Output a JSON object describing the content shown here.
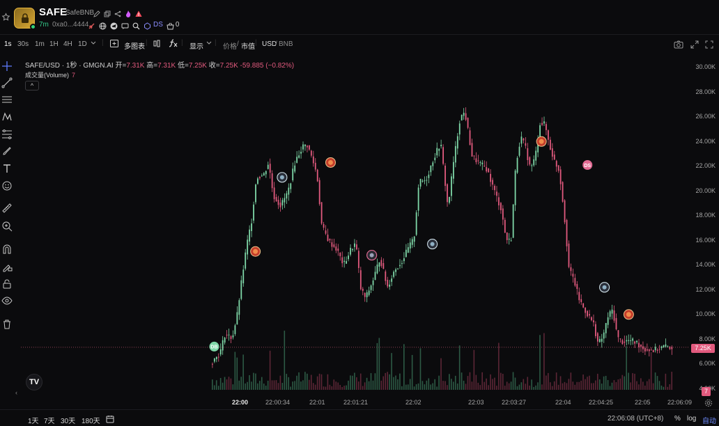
{
  "token": {
    "ticker": "SAFE",
    "name": "SafeBNB",
    "age": "7m",
    "address": "0xa0...4444",
    "ds_label": "DS",
    "count": "0"
  },
  "toolbar": {
    "intervals": [
      "1s",
      "30s",
      "1m",
      "1H",
      "4H",
      "1D"
    ],
    "active_interval": "1s",
    "multi_chart": "多图表",
    "display": "显示",
    "price": "价格",
    "mcap": "市值",
    "usd": "USD",
    "bnb": "BNB",
    "slash": "/"
  },
  "legend": {
    "symbol": "SAFE/USD · 1秒 · GMGN.AI",
    "open_label": "开=",
    "open": "7.31K",
    "high_label": "高=",
    "high": "7.31K",
    "low_label": "低=",
    "low": "7.25K",
    "close_label": "收=",
    "close": "7.25K",
    "change": "-59.885 (−0.82%)",
    "volume_label": "成交量(Volume)",
    "volume": "7",
    "fold": "^"
  },
  "y_axis": [
    "30.00K",
    "28.00K",
    "26.00K",
    "24.00K",
    "22.00K",
    "20.00K",
    "18.00K",
    "16.00K",
    "14.00K",
    "12.00K",
    "10.00K",
    "8.00K",
    "6.00K",
    "4.00K"
  ],
  "current_price": "7.25K",
  "current_volume": "7",
  "x_axis": [
    "22:00",
    "22:00:34",
    "22:01",
    "22:01:21",
    "22:02",
    "22:03",
    "22:03:27",
    "22:04",
    "22:04:25",
    "22:05",
    "22:06:09"
  ],
  "bottom": {
    "ranges": [
      "1天",
      "7天",
      "30天",
      "180天"
    ],
    "clock": "22:06:08 (UTC+8)",
    "percent": "%",
    "log": "log",
    "auto": "自动"
  },
  "colors": {
    "up": "#7fd8a8",
    "down": "#e25a7e",
    "accent": "#6f8dff"
  },
  "markers": [
    "DB",
    "DS"
  ],
  "tv_logo": "TV",
  "chart_data": {
    "type": "candlestick",
    "xlabel": "",
    "ylabel": "",
    "ylim": [
      4000,
      30000
    ],
    "price_path": [
      {
        "t": 0,
        "p": 5900
      },
      {
        "t": 4,
        "p": 6800
      },
      {
        "t": 6,
        "p": 8300
      },
      {
        "t": 9,
        "p": 8000
      },
      {
        "t": 11,
        "p": 9800
      },
      {
        "t": 13,
        "p": 12800
      },
      {
        "t": 15,
        "p": 15500
      },
      {
        "t": 17,
        "p": 17500
      },
      {
        "t": 19,
        "p": 21000
      },
      {
        "t": 22,
        "p": 21200
      },
      {
        "t": 24,
        "p": 22200
      },
      {
        "t": 26,
        "p": 19500
      },
      {
        "t": 29,
        "p": 18700
      },
      {
        "t": 32,
        "p": 19800
      },
      {
        "t": 35,
        "p": 22300
      },
      {
        "t": 38,
        "p": 23500
      },
      {
        "t": 40,
        "p": 23600
      },
      {
        "t": 42,
        "p": 22500
      },
      {
        "t": 44,
        "p": 21200
      },
      {
        "t": 46,
        "p": 17000
      },
      {
        "t": 49,
        "p": 15800
      },
      {
        "t": 52,
        "p": 15200
      },
      {
        "t": 55,
        "p": 13900
      },
      {
        "t": 58,
        "p": 15200
      },
      {
        "t": 60,
        "p": 15700
      },
      {
        "t": 62,
        "p": 12000
      },
      {
        "t": 64,
        "p": 11200
      },
      {
        "t": 67,
        "p": 12600
      },
      {
        "t": 70,
        "p": 14500
      },
      {
        "t": 73,
        "p": 12100
      },
      {
        "t": 76,
        "p": 13500
      },
      {
        "t": 79,
        "p": 14200
      },
      {
        "t": 82,
        "p": 15400
      },
      {
        "t": 84,
        "p": 16000
      },
      {
        "t": 86,
        "p": 20600
      },
      {
        "t": 89,
        "p": 20800
      },
      {
        "t": 92,
        "p": 22500
      },
      {
        "t": 95,
        "p": 23800
      },
      {
        "t": 98,
        "p": 18500
      },
      {
        "t": 100,
        "p": 21800
      },
      {
        "t": 103,
        "p": 25800
      },
      {
        "t": 105,
        "p": 26300
      },
      {
        "t": 108,
        "p": 22700
      },
      {
        "t": 111,
        "p": 22100
      },
      {
        "t": 114,
        "p": 21700
      },
      {
        "t": 117,
        "p": 20000
      },
      {
        "t": 120,
        "p": 18400
      },
      {
        "t": 122,
        "p": 16000
      },
      {
        "t": 124,
        "p": 15800
      },
      {
        "t": 126,
        "p": 22000
      },
      {
        "t": 128,
        "p": 24300
      },
      {
        "t": 130,
        "p": 23400
      },
      {
        "t": 132,
        "p": 21700
      },
      {
        "t": 134,
        "p": 22600
      },
      {
        "t": 136,
        "p": 25400
      },
      {
        "t": 138,
        "p": 25300
      },
      {
        "t": 140,
        "p": 23500
      },
      {
        "t": 142,
        "p": 22300
      },
      {
        "t": 144,
        "p": 21500
      },
      {
        "t": 146,
        "p": 18000
      },
      {
        "t": 148,
        "p": 13500
      },
      {
        "t": 150,
        "p": 12700
      },
      {
        "t": 152,
        "p": 11200
      },
      {
        "t": 154,
        "p": 10400
      },
      {
        "t": 156,
        "p": 9800
      },
      {
        "t": 158,
        "p": 9200
      },
      {
        "t": 160,
        "p": 7500
      },
      {
        "t": 162,
        "p": 8100
      },
      {
        "t": 164,
        "p": 9700
      },
      {
        "t": 166,
        "p": 10300
      },
      {
        "t": 168,
        "p": 8000
      },
      {
        "t": 170,
        "p": 7700
      },
      {
        "t": 173,
        "p": 7800
      },
      {
        "t": 176,
        "p": 7600
      },
      {
        "t": 179,
        "p": 7100
      },
      {
        "t": 183,
        "p": 7000
      },
      {
        "t": 187,
        "p": 7300
      },
      {
        "t": 190,
        "p": 7250
      }
    ],
    "t_max": 190
  }
}
